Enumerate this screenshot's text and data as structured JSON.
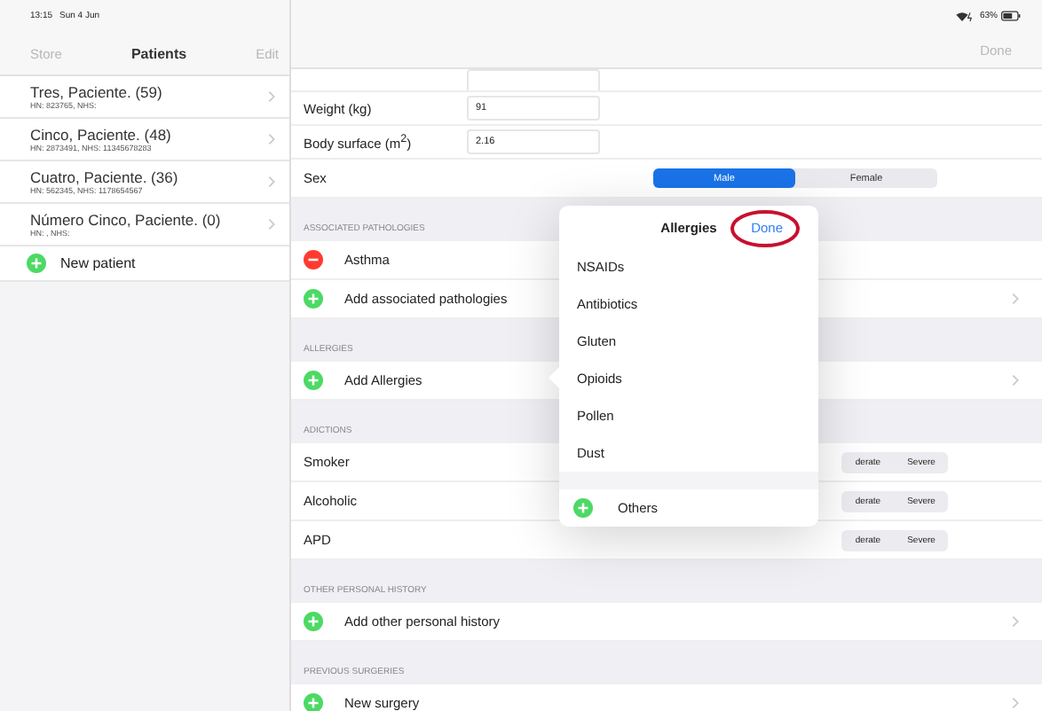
{
  "status_bar": {
    "time": "13:15",
    "date": "Sun 4 Jun",
    "battery": "63%"
  },
  "sidebar": {
    "left_button": "Store",
    "title": "Patients",
    "right_button": "Edit",
    "patients": [
      {
        "name": "Tres, Paciente. (59)",
        "detail": "HN: 823765, NHS:"
      },
      {
        "name": "Cinco, Paciente. (48)",
        "detail": "HN: 2873491, NHS: 11345678283"
      },
      {
        "name": "Cuatro, Paciente. (36)",
        "detail": "HN: 562345, NHS: 1178654567"
      },
      {
        "name": "Número Cinco, Paciente. (0)",
        "detail": "HN: , NHS:"
      }
    ],
    "new_patient": "New patient"
  },
  "nav": {
    "done": "Done"
  },
  "fields": [
    {
      "label": "Weight (kg)",
      "value": "91"
    },
    {
      "label": "Body surface (m$^{2}$)",
      "value": "2.16"
    }
  ],
  "sex": {
    "label": "Sex",
    "options": [
      {
        "label": "Male",
        "selected": true
      },
      {
        "label": "Female",
        "selected": false
      }
    ]
  },
  "sections": [
    {
      "header": "ASSOCIATED PATHOLOGIES",
      "rows": [
        {
          "kind": "remove",
          "label": "Asthma"
        },
        {
          "kind": "add",
          "label": "Add associated pathologies"
        }
      ]
    },
    {
      "header": "ALLERGIES",
      "rows": [
        {
          "kind": "add",
          "label": "Add Allergies"
        }
      ]
    },
    {
      "header": "ADICTIONS",
      "rows": [
        {
          "kind": "severity",
          "label": "Smoker",
          "options": [
            "derate",
            "Severe"
          ]
        },
        {
          "kind": "severity",
          "label": "Alcoholic",
          "options": [
            "derate",
            "Severe"
          ]
        },
        {
          "kind": "severity",
          "label": "APD",
          "options": [
            "derate",
            "Severe"
          ]
        }
      ]
    },
    {
      "header": "OTHER PERSONAL HISTORY",
      "rows": [
        {
          "kind": "add",
          "label": "Add other personal history"
        }
      ]
    },
    {
      "header": "PREVIOUS SURGERIES",
      "rows": [
        {
          "kind": "add",
          "label": "New surgery"
        }
      ]
    }
  ],
  "popover": {
    "title": "Allergies",
    "done": "Done",
    "items": [
      "NSAIDs",
      "Antibiotics",
      "Gluten",
      "Opioids",
      "Pollen",
      "Dust"
    ],
    "others": "Others"
  }
}
